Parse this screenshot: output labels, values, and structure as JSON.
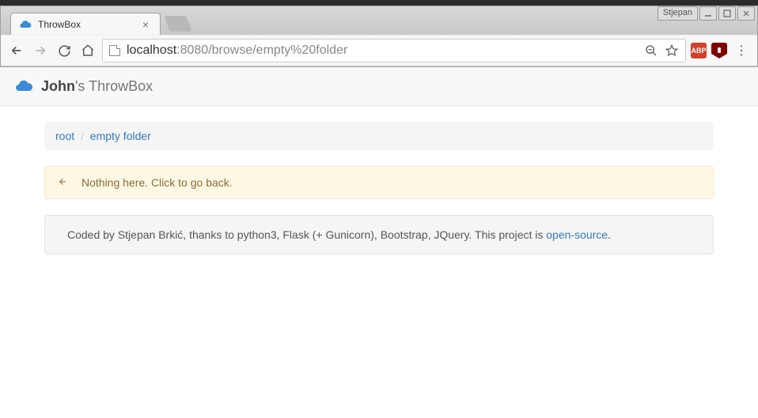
{
  "window": {
    "user_label": "Stjepan"
  },
  "browser": {
    "tab_title": "ThrowBox",
    "url_host": "localhost",
    "url_path": ":8080/browse/empty%20folder"
  },
  "app": {
    "owner": "John",
    "title_suffix": "'s ThrowBox"
  },
  "breadcrumb": {
    "root": "root",
    "current": "empty folder"
  },
  "alert": {
    "message": "Nothing here. Click to go back."
  },
  "footer": {
    "text_before": "Coded by Stjepan Brkić, thanks to python3, Flask (+ Gunicorn), Bootstrap, JQuery. This project is ",
    "link": "open-source",
    "text_after": "."
  },
  "extensions": {
    "abp": "ABP"
  }
}
